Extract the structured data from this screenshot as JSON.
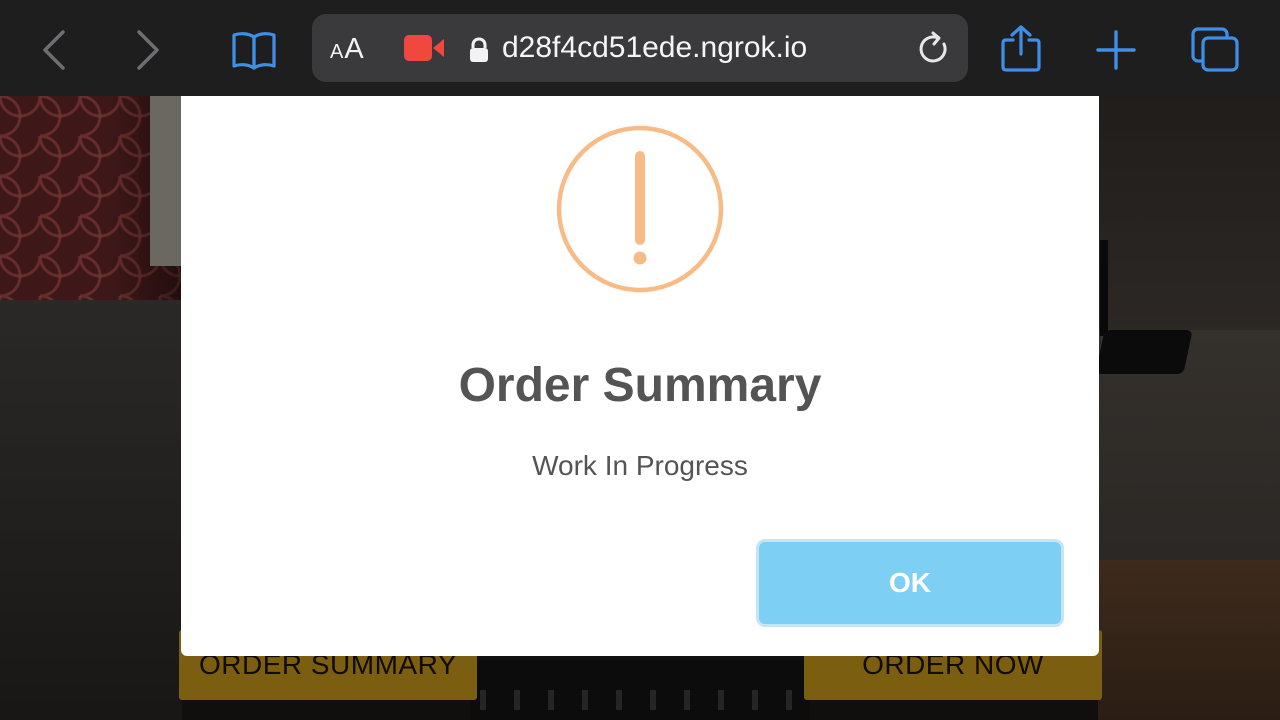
{
  "browser": {
    "url": "d28f4cd51ede.ngrok.io",
    "text_size_small": "A",
    "text_size_large": "A",
    "accent_color": "#3e8fe8",
    "icons": [
      "back-icon",
      "forward-icon",
      "book-icon",
      "recording-icon",
      "lock-icon",
      "reload-icon",
      "share-icon",
      "plus-icon",
      "tabs-icon"
    ]
  },
  "page": {
    "order_summary_button": "ORDER SUMMARY",
    "order_now_button": "ORDER NOW",
    "button_color": "#d6a21c"
  },
  "modal": {
    "icon": "warning-icon",
    "icon_color": "#f8bb86",
    "title": "Order Summary",
    "text": "Work In Progress",
    "ok_button": "OK",
    "ok_button_color": "#7ecff4"
  }
}
